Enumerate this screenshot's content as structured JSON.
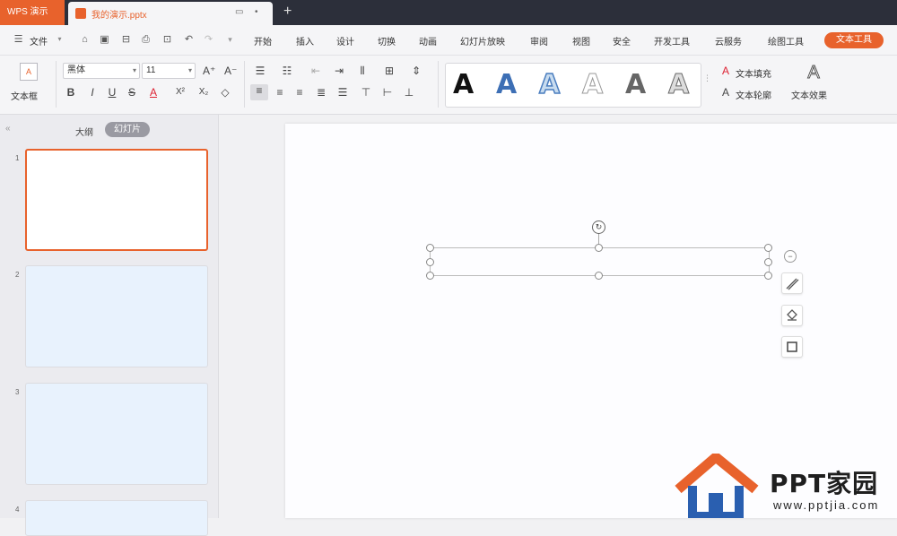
{
  "titlebar": {
    "app_tab": "WPS 演示",
    "doc_tab": "我的演示.pptx",
    "new_tab_symbol": "+"
  },
  "menubar": {
    "file_label": "文件",
    "tabs": [
      "开始",
      "插入",
      "设计",
      "切换",
      "动画",
      "幻灯片放映",
      "审阅",
      "视图",
      "安全",
      "开发工具",
      "云服务",
      "绘图工具"
    ],
    "active_contextual_tab": "文本工具"
  },
  "ribbon": {
    "text_box_label": "文本框",
    "font_name": "黑体",
    "font_size": "11",
    "gallery_glyph": "A",
    "text_fill_label": "文本填充",
    "text_outline_label": "文本轮廓",
    "text_effect_label": "文本效果",
    "format_buttons": [
      "B",
      "I",
      "U",
      "S",
      "A",
      "X²",
      "X₂",
      "◇"
    ]
  },
  "panel": {
    "tab_outline": "大纲",
    "tab_slides": "幻灯片",
    "slide_numbers": [
      "1",
      "2",
      "3",
      "4"
    ]
  },
  "watermark": {
    "brand": "PPT家园",
    "url": "www.pptjia.com"
  },
  "colors": {
    "accent": "#e8622c",
    "titlebar": "#2c2f3a",
    "thumb_fill": "#e8f2fd"
  }
}
